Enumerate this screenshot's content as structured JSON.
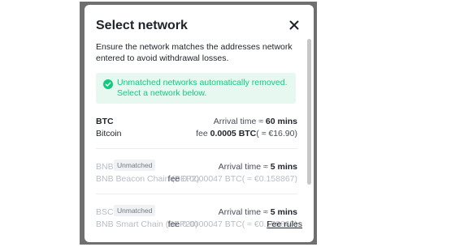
{
  "modal": {
    "title": "Select network",
    "close_icon": "close-icon",
    "intro": "Ensure the network matches the addresses network entered to avoid withdrawal losses.",
    "notice": {
      "icon": "check-circle-icon",
      "text": "Unmatched networks automatically removed. Select a network below.",
      "color": "#0ecb81",
      "background": "#e7f8f0"
    },
    "networks": [
      {
        "code": "BTC",
        "badge": "",
        "name": "Bitcoin",
        "arrival_label": "Arrival time ≈",
        "arrival_value": "60 mins",
        "fee_label": "fee",
        "fee_value": "0.0005 BTC",
        "fee_fiat": "( ≈ €16.90)",
        "enabled": true
      },
      {
        "code": "BNB",
        "badge": "Unmatched",
        "name": "BNB Beacon Chain (BEP2)",
        "arrival_label": "Arrival time ≈",
        "arrival_value": "5 mins",
        "fee_label": "fee",
        "fee_value": "0.0000047 BTC",
        "fee_fiat": "( ≈ €0.158867)",
        "enabled": false
      },
      {
        "code": "BSC",
        "badge": "Unmatched",
        "name": "BNB Smart Chain (BEP20)",
        "arrival_label": "Arrival time ≈",
        "arrival_value": "5 mins",
        "fee_label": "fee",
        "fee_value": "0.0000047 BTC",
        "fee_fiat": "( ≈ €0.158867)",
        "enabled": false
      }
    ],
    "fee_rules_link": "Fee rules"
  }
}
